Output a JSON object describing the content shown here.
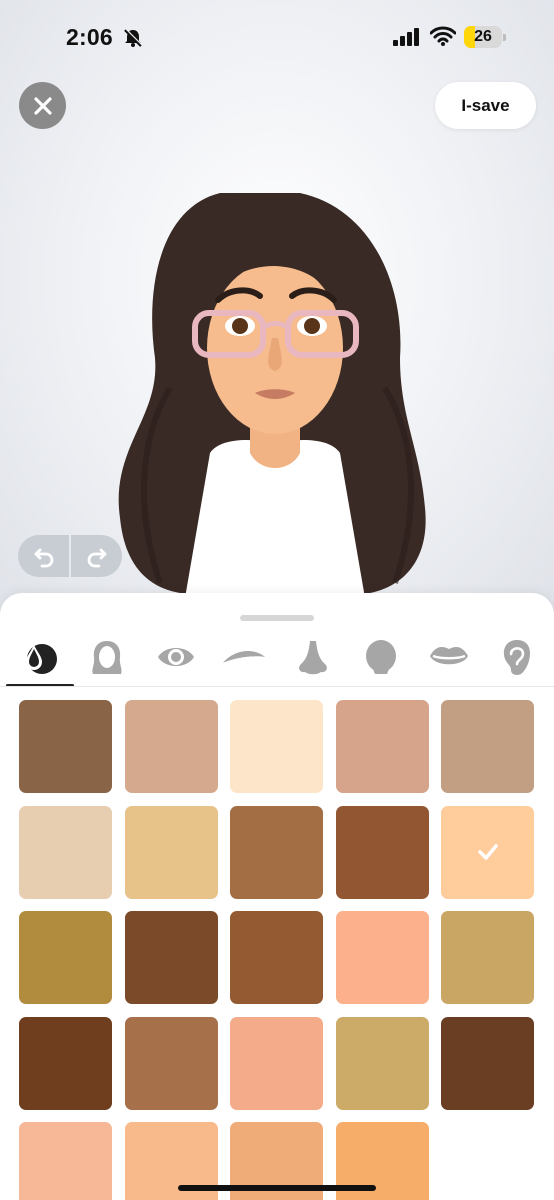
{
  "status": {
    "time": "2:06",
    "battery": "26"
  },
  "header": {
    "save_label": "I-save"
  },
  "tabs": [
    {
      "name": "skin-tab",
      "icon": "skin-drop-icon",
      "selected": true
    },
    {
      "name": "hair-tab",
      "icon": "hair-icon",
      "selected": false
    },
    {
      "name": "eyes-tab",
      "icon": "eye-icon",
      "selected": false
    },
    {
      "name": "eyebrows-tab",
      "icon": "eyebrow-icon",
      "selected": false
    },
    {
      "name": "nose-tab",
      "icon": "nose-icon",
      "selected": false
    },
    {
      "name": "head-tab",
      "icon": "head-icon",
      "selected": false
    },
    {
      "name": "lips-tab",
      "icon": "lips-icon",
      "selected": false
    },
    {
      "name": "ears-tab",
      "icon": "ear-icon",
      "selected": false
    }
  ],
  "swatches": [
    "#8a6446",
    "#d4a98e",
    "#fde5c9",
    "#d6a38b",
    "#c29f83",
    "#e7ceb1",
    "#e7c389",
    "#a36e43",
    "#935632",
    "#ffcc9c",
    "#b18b3e",
    "#7b4b29",
    "#945a31",
    "#fdb08c",
    "#c9a663",
    "#6f3e1f",
    "#a6704b",
    "#f4ab8a",
    "#ccaa68",
    "#6a3e23",
    "#f6b896",
    "#f8b98b",
    "#efab78",
    "#f6ad6a"
  ],
  "selected_swatch": 9
}
